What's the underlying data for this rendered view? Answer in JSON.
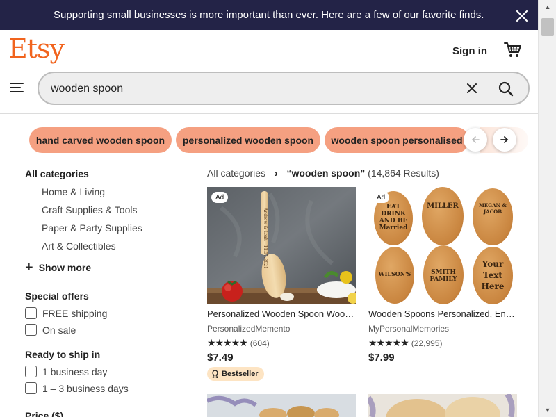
{
  "banner": {
    "text": "Supporting small businesses is more important than ever. Here are a few of our favorite finds.",
    "close_icon": "close-icon"
  },
  "header": {
    "logo": "Etsy",
    "sign_in": "Sign in",
    "cart_icon": "cart-icon",
    "menu_icon": "menu-icon"
  },
  "search": {
    "value": "wooden spoon",
    "clear_icon": "close-icon",
    "search_icon": "search-icon"
  },
  "suggestions": {
    "chips": [
      "hand carved wooden spoon",
      "personalized wooden spoon",
      "wooden spoon personalised"
    ],
    "prev_icon": "arrow-left-icon",
    "next_icon": "arrow-right-icon"
  },
  "sidebar": {
    "all_categories": "All categories",
    "categories": [
      "Home & Living",
      "Craft Supplies & Tools",
      "Paper & Party Supplies",
      "Art & Collectibles"
    ],
    "show_more": "Show more",
    "special_offers": {
      "heading": "Special offers",
      "options": [
        "FREE shipping",
        "On sale"
      ]
    },
    "ready_to_ship": {
      "heading": "Ready to ship in",
      "options": [
        "1 business day",
        "1 – 3 business days"
      ]
    },
    "price_heading": "Price ($)"
  },
  "breadcrumb": {
    "root": "All categories",
    "query": "“wooden spoon”",
    "count": "(14,864 Results)"
  },
  "listings": [
    {
      "ad": "Ad",
      "title": "Personalized Wooden Spoon Wooden Spoon Engraved",
      "shop": "PersonalizedMemento",
      "stars": "★★★★★",
      "reviews": "(604)",
      "price": "$7.49",
      "badge": "Bestseller",
      "engraving": "Andrew & Leah · 11.07.2021"
    },
    {
      "ad": "Ad",
      "title": "Wooden Spoons Personalized, Engraved Spoon",
      "shop": "MyPersonalMemories",
      "stars": "★★★★★",
      "reviews": "(22,995)",
      "price": "$7.99",
      "spoons": [
        "EAT DRINK AND BE Married",
        "MILLER",
        "MEGAN & JACOB",
        "WILSON'S",
        "SMITH FAMILY",
        "Your Text Here"
      ]
    }
  ],
  "colors": {
    "brand": "#f1641e",
    "banner_bg": "#232347",
    "chip": "#f5a081",
    "bestseller": "#fde4c3"
  }
}
